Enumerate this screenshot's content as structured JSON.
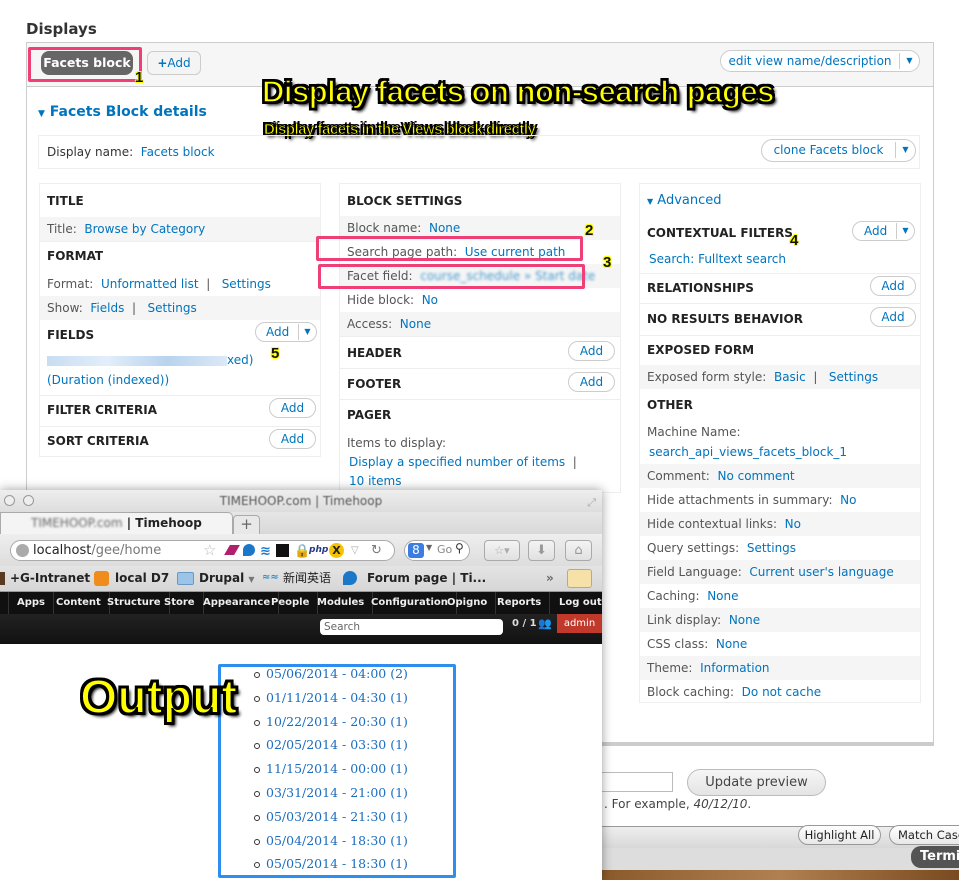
{
  "page": {
    "section_title": "Displays"
  },
  "displays_bar": {
    "active_tab": "Facets block",
    "add_label": "Add",
    "edit_view_label": "edit view name/description"
  },
  "annotations": {
    "headline": "Display facets on non-search pages",
    "subhead": "Display facets in the Views block directly",
    "output_label": "Output",
    "markers": [
      "1",
      "2",
      "3",
      "4",
      "5"
    ]
  },
  "details": {
    "title": "Facets Block details",
    "display_name_label": "Display name:",
    "display_name_value": "Facets block",
    "clone_label": "clone Facets block"
  },
  "col1": {
    "title_heading": "TITLE",
    "title_label": "Title:",
    "title_value": "Browse by Category",
    "format_heading": "FORMAT",
    "format_label": "Format:",
    "format_value": "Unformatted list",
    "format_settings": "Settings",
    "show_label": "Show:",
    "show_value": "Fields",
    "show_settings": "Settings",
    "fields_heading": "FIELDS",
    "fields_add": "Add",
    "field_1": "(blurred) (indexed)",
    "field_1_visible": "xed)",
    "field_2": "(Duration (indexed))",
    "filter_heading": "FILTER CRITERIA",
    "filter_add": "Add",
    "sort_heading": "SORT CRITERIA",
    "sort_add": "Add"
  },
  "col2": {
    "block_heading": "BLOCK SETTINGS",
    "block_name_label": "Block name:",
    "block_name_value": "None",
    "search_path_label": "Search page path:",
    "search_path_value": "Use current path",
    "facet_field_label": "Facet field:",
    "facet_field_value": "course_schedule » Start date",
    "hide_block_label": "Hide block:",
    "hide_block_value": "No",
    "access_label": "Access:",
    "access_value": "None",
    "header_heading": "HEADER",
    "header_add": "Add",
    "footer_heading": "FOOTER",
    "footer_add": "Add",
    "pager_heading": "PAGER",
    "items_label": "Items to display:",
    "items_value": "Display a specified number of items",
    "items_count": "10 items"
  },
  "col3": {
    "advanced_label": "Advanced",
    "contextual_heading": "CONTEXTUAL FILTERS",
    "contextual_add": "Add",
    "contextual_value": "Search: Fulltext search",
    "relationships_heading": "RELATIONSHIPS",
    "relationships_add": "Add",
    "noresults_heading": "NO RESULTS BEHAVIOR",
    "noresults_add": "Add",
    "exposed_heading": "EXPOSED FORM",
    "exposed_label": "Exposed form style:",
    "exposed_value": "Basic",
    "exposed_settings": "Settings",
    "other_heading": "OTHER",
    "other_rows": [
      {
        "label": "Machine Name:",
        "value": "search_api_views_facets_block_1"
      },
      {
        "label": "Comment:",
        "value": "No comment"
      },
      {
        "label": "Hide attachments in summary:",
        "value": "No"
      },
      {
        "label": "Hide contextual links:",
        "value": "No"
      },
      {
        "label": "Query settings:",
        "value": "Settings"
      },
      {
        "label": "Field Language:",
        "value": "Current user's language"
      },
      {
        "label": "Caching:",
        "value": "None"
      },
      {
        "label": "Link display:",
        "value": "None"
      },
      {
        "label": "CSS class:",
        "value": "None"
      },
      {
        "label": "Theme:",
        "value": "Information"
      },
      {
        "label": "Block caching:",
        "value": "Do not cache"
      }
    ]
  },
  "preview": {
    "update_button": "Update preview",
    "hint_prefix": ". For example, ",
    "hint_example": "40/12/10",
    "hint_suffix": "."
  },
  "findbar": {
    "highlight_all": "Highlight All",
    "match_case": "Match Case",
    "terminal_tooltip": "Termi"
  },
  "browser": {
    "window_title": "TIMEHOOP.com | Timehoop",
    "tab_title_blurred": "TIMEHOOP.com",
    "tab_title": "Timehoop",
    "url_host": "localhost",
    "url_path": "/gee/home",
    "search_engine_placeholder": "Go",
    "bookmarks": [
      "+G-Intranet",
      "local D7",
      "Drupal",
      "新闻英语",
      "Forum page | Ti..."
    ],
    "admin_menu": [
      "Apps",
      "Content",
      "Structure",
      "Store",
      "Appearance",
      "People",
      "Modules",
      "Configuration",
      "Opigno",
      "Reports"
    ],
    "logout": "Log out",
    "search_placeholder": "Search",
    "user_count": "0 / 1",
    "user_name": "admin"
  },
  "output_list": [
    "05/06/2014 - 04:00 (2)",
    "01/11/2014 - 04:30 (1)",
    "10/22/2014 - 20:30 (1)",
    "02/05/2014 - 03:30 (1)",
    "11/15/2014 - 00:00 (1)",
    "03/31/2014 - 21:00 (1)",
    "05/03/2014 - 21:30 (1)",
    "05/04/2014 - 18:30 (1)",
    "05/05/2014 - 18:30 (1)"
  ],
  "colors": {
    "link": "#0074bd",
    "highlight_box": "#ef3f77",
    "output_box": "#2d8ef0",
    "annotation_text": "#ffff00",
    "admin_user_bg": "#c0392b"
  }
}
